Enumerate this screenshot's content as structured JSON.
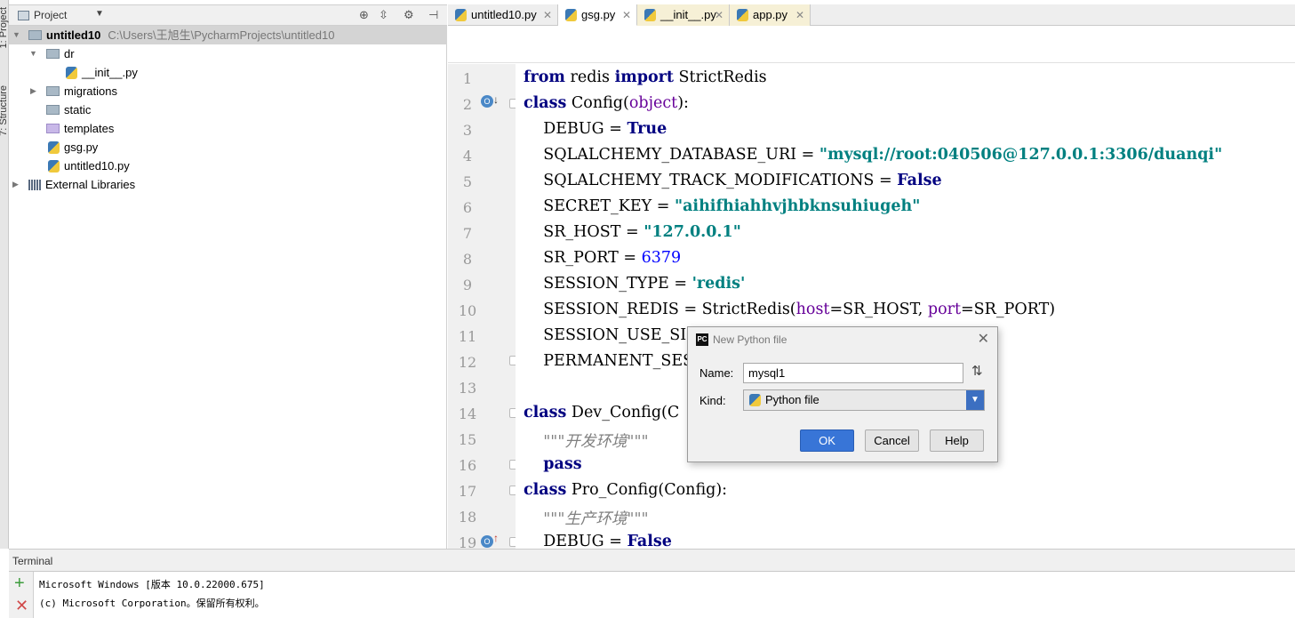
{
  "left_strip": {
    "project_tab": "1: Project",
    "structure_tab": "7: Structure"
  },
  "project_panel": {
    "title": "Project",
    "tree": [
      {
        "label": "untitled10",
        "path": "C:\\Users\\王旭生\\PycharmProjects\\untitled10",
        "type": "folder",
        "expanded": true
      },
      {
        "label": "dr",
        "type": "folder",
        "expanded": true
      },
      {
        "label": "__init__.py",
        "type": "python-file"
      },
      {
        "label": "migrations",
        "type": "folder",
        "expanded": false
      },
      {
        "label": "static",
        "type": "folder"
      },
      {
        "label": "templates",
        "type": "folder"
      },
      {
        "label": "gsg.py",
        "type": "python-file"
      },
      {
        "label": "untitled10.py",
        "type": "python-file"
      },
      {
        "label": "External Libraries",
        "type": "library",
        "expanded": false
      }
    ]
  },
  "editor_tabs": [
    {
      "label": "untitled10.py",
      "active": false
    },
    {
      "label": "gsg.py",
      "active": true
    },
    {
      "label": "__init__.py",
      "active": false
    },
    {
      "label": "app.py",
      "active": false
    }
  ],
  "editor": {
    "line_numbers": [
      "1",
      "2",
      "3",
      "4",
      "5",
      "6",
      "7",
      "8",
      "9",
      "10",
      "11",
      "12",
      "13",
      "14",
      "15",
      "16",
      "17",
      "18",
      "19"
    ],
    "current_line": "13"
  },
  "dialog": {
    "title": "New Python file",
    "name_label": "Name:",
    "name_value": "mysql1",
    "kind_label": "Kind:",
    "kind_value": "Python file",
    "ok": "OK",
    "cancel": "Cancel",
    "help": "Help"
  },
  "terminal": {
    "title": "Terminal",
    "lines": [
      "Microsoft Windows [版本 10.0.22000.675]",
      "(c) Microsoft Corporation。保留所有权利。"
    ]
  },
  "colors": {
    "keyword": "#000080",
    "string": "#008080",
    "number": "#0000ff",
    "param": "#660099",
    "ok_button": "#3875d7"
  }
}
